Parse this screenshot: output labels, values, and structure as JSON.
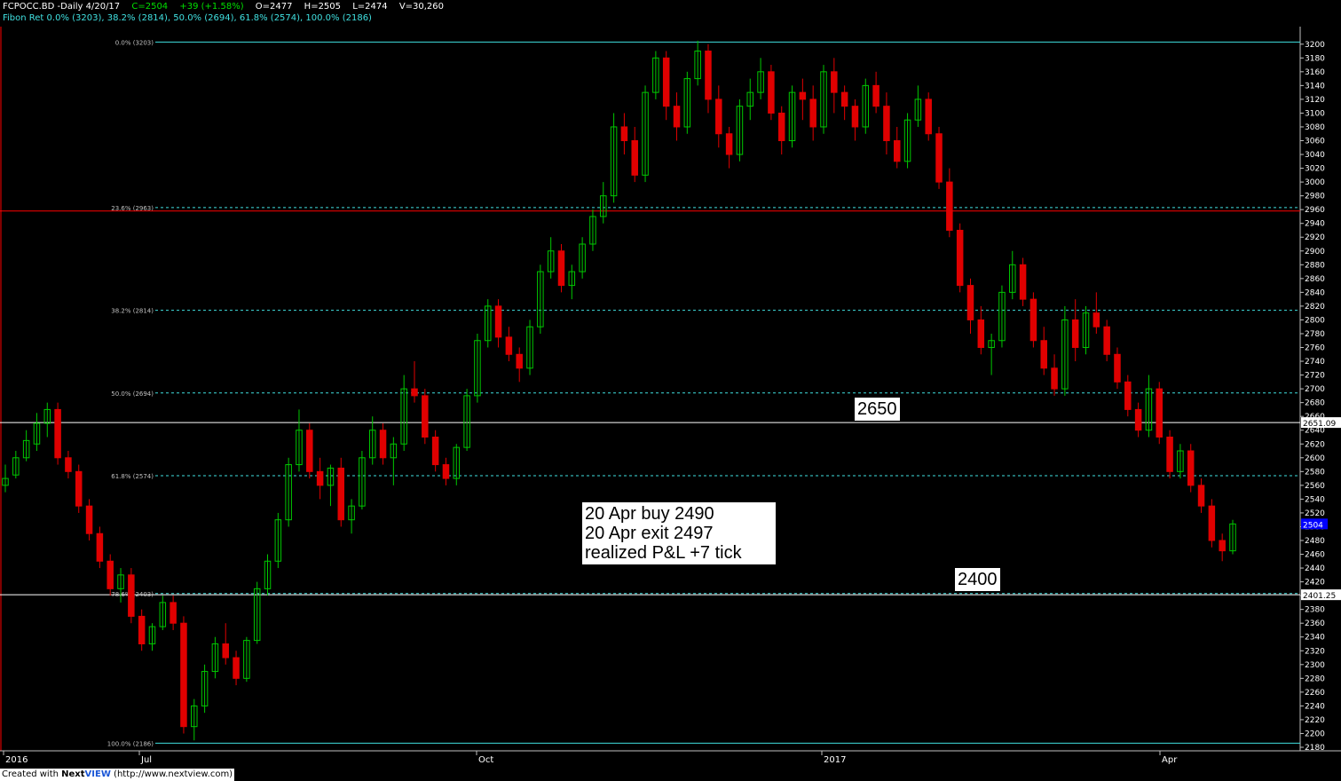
{
  "header": {
    "symbol_line": "FCPOCC.BD -Daily  4/20/17",
    "close": "C=2504",
    "change": "+39 (+1.58%)",
    "open": "O=2477",
    "high": "H=2505",
    "low": "L=2474",
    "volume": "V=30,260",
    "fib_line": "Fibon Ret 0.0% (3203), 38.2% (2814), 50.0% (2694), 61.8% (2574), 100.0% (2186)"
  },
  "annotations": {
    "trade_line1": "20 Apr buy 2490",
    "trade_line2": "20 Apr exit 2497",
    "trade_line3": "realized P&L +7 tick",
    "level_upper": "2650",
    "level_lower": "2400"
  },
  "footer": {
    "prefix": "Created with ",
    "brand_a": "Next",
    "brand_b": "VIEW",
    "url": " (http://www.nextview.com)"
  },
  "colors": {
    "background": "#000000",
    "up_candle": "#00c800",
    "down_candle": "#e00000",
    "fib_line": "#40e0e0",
    "resistance_line": "#ff0000",
    "price_tag": "#0000ff"
  },
  "chart_data": {
    "type": "candlestick",
    "title": "FCPOCC.BD -Daily",
    "ylim": [
      2180,
      3210
    ],
    "y_ticks": [
      2180,
      2200,
      2220,
      2240,
      2260,
      2280,
      2300,
      2320,
      2340,
      2360,
      2380,
      2400,
      2420,
      2440,
      2460,
      2480,
      2500,
      2520,
      2540,
      2560,
      2580,
      2600,
      2620,
      2640,
      2660,
      2680,
      2700,
      2720,
      2740,
      2760,
      2780,
      2800,
      2820,
      2840,
      2860,
      2880,
      2900,
      2920,
      2940,
      2960,
      2980,
      3000,
      3020,
      3040,
      3060,
      3080,
      3100,
      3120,
      3140,
      3160,
      3180,
      3200
    ],
    "x_labels": [
      "2016",
      "Jul",
      "Oct",
      "2017",
      "Apr"
    ],
    "fib_levels": [
      {
        "label": "0.0% (3203)",
        "value": 3203
      },
      {
        "label": "23.6% (2963)",
        "value": 2963
      },
      {
        "label": "38.2% (2814)",
        "value": 2814
      },
      {
        "label": "50.0% (2694)",
        "value": 2694
      },
      {
        "label": "61.8% (2574)",
        "value": 2574
      },
      {
        "label": "78.6% (2403)",
        "value": 2403
      },
      {
        "label": "100.0% (2186)",
        "value": 2186
      }
    ],
    "horizontal_lines": [
      {
        "value": 2958,
        "color": "#ff0000"
      },
      {
        "value": 2651.09,
        "color": "#ffffff",
        "label": "2651.09"
      },
      {
        "value": 2401.25,
        "color": "#ffffff",
        "label": "2401.25"
      }
    ],
    "last_price": {
      "value": 2504,
      "label": "2504"
    },
    "candles_ohlc": [
      [
        2560,
        2590,
        2550,
        2570
      ],
      [
        2575,
        2610,
        2570,
        2600
      ],
      [
        2600,
        2640,
        2595,
        2625
      ],
      [
        2620,
        2665,
        2610,
        2650
      ],
      [
        2650,
        2680,
        2630,
        2670
      ],
      [
        2670,
        2680,
        2590,
        2600
      ],
      [
        2600,
        2610,
        2570,
        2580
      ],
      [
        2580,
        2590,
        2520,
        2530
      ],
      [
        2530,
        2540,
        2480,
        2490
      ],
      [
        2490,
        2500,
        2440,
        2450
      ],
      [
        2450,
        2460,
        2400,
        2410
      ],
      [
        2410,
        2440,
        2390,
        2430
      ],
      [
        2430,
        2440,
        2360,
        2370
      ],
      [
        2370,
        2380,
        2320,
        2330
      ],
      [
        2330,
        2360,
        2320,
        2355
      ],
      [
        2355,
        2400,
        2350,
        2390
      ],
      [
        2390,
        2400,
        2350,
        2360
      ],
      [
        2360,
        2370,
        2200,
        2210
      ],
      [
        2210,
        2250,
        2190,
        2240
      ],
      [
        2240,
        2300,
        2230,
        2290
      ],
      [
        2290,
        2340,
        2280,
        2330
      ],
      [
        2330,
        2360,
        2300,
        2310
      ],
      [
        2310,
        2320,
        2270,
        2280
      ],
      [
        2280,
        2340,
        2275,
        2335
      ],
      [
        2335,
        2420,
        2330,
        2410
      ],
      [
        2410,
        2460,
        2400,
        2450
      ],
      [
        2450,
        2520,
        2440,
        2510
      ],
      [
        2510,
        2600,
        2500,
        2590
      ],
      [
        2590,
        2670,
        2580,
        2640
      ],
      [
        2640,
        2650,
        2570,
        2580
      ],
      [
        2580,
        2600,
        2540,
        2560
      ],
      [
        2560,
        2590,
        2530,
        2585
      ],
      [
        2585,
        2600,
        2500,
        2510
      ],
      [
        2510,
        2540,
        2490,
        2530
      ],
      [
        2530,
        2610,
        2525,
        2600
      ],
      [
        2600,
        2660,
        2590,
        2640
      ],
      [
        2640,
        2650,
        2590,
        2600
      ],
      [
        2600,
        2630,
        2560,
        2620
      ],
      [
        2620,
        2720,
        2610,
        2700
      ],
      [
        2700,
        2740,
        2680,
        2690
      ],
      [
        2690,
        2700,
        2620,
        2630
      ],
      [
        2630,
        2640,
        2580,
        2590
      ],
      [
        2590,
        2600,
        2560,
        2570
      ],
      [
        2570,
        2620,
        2560,
        2615
      ],
      [
        2615,
        2700,
        2610,
        2690
      ],
      [
        2690,
        2780,
        2680,
        2770
      ],
      [
        2770,
        2830,
        2760,
        2820
      ],
      [
        2820,
        2830,
        2760,
        2775
      ],
      [
        2775,
        2790,
        2740,
        2750
      ],
      [
        2750,
        2760,
        2710,
        2730
      ],
      [
        2730,
        2800,
        2720,
        2790
      ],
      [
        2790,
        2880,
        2780,
        2870
      ],
      [
        2870,
        2920,
        2860,
        2900
      ],
      [
        2900,
        2910,
        2840,
        2850
      ],
      [
        2850,
        2880,
        2830,
        2870
      ],
      [
        2870,
        2920,
        2860,
        2910
      ],
      [
        2910,
        2960,
        2900,
        2950
      ],
      [
        2950,
        3000,
        2940,
        2980
      ],
      [
        2980,
        3100,
        2970,
        3080
      ],
      [
        3080,
        3100,
        3040,
        3060
      ],
      [
        3060,
        3080,
        3000,
        3010
      ],
      [
        3010,
        3140,
        3000,
        3130
      ],
      [
        3130,
        3190,
        3120,
        3180
      ],
      [
        3180,
        3190,
        3090,
        3110
      ],
      [
        3110,
        3130,
        3060,
        3080
      ],
      [
        3080,
        3160,
        3070,
        3150
      ],
      [
        3150,
        3205,
        3140,
        3190
      ],
      [
        3190,
        3200,
        3100,
        3120
      ],
      [
        3120,
        3140,
        3050,
        3070
      ],
      [
        3070,
        3080,
        3020,
        3040
      ],
      [
        3040,
        3120,
        3030,
        3110
      ],
      [
        3110,
        3150,
        3090,
        3130
      ],
      [
        3130,
        3180,
        3120,
        3160
      ],
      [
        3160,
        3170,
        3090,
        3100
      ],
      [
        3100,
        3110,
        3040,
        3060
      ],
      [
        3060,
        3140,
        3050,
        3130
      ],
      [
        3130,
        3150,
        3090,
        3120
      ],
      [
        3120,
        3140,
        3060,
        3080
      ],
      [
        3080,
        3170,
        3070,
        3160
      ],
      [
        3160,
        3180,
        3100,
        3130
      ],
      [
        3130,
        3140,
        3090,
        3110
      ],
      [
        3110,
        3120,
        3060,
        3080
      ],
      [
        3080,
        3150,
        3070,
        3140
      ],
      [
        3140,
        3160,
        3100,
        3110
      ],
      [
        3110,
        3130,
        3040,
        3060
      ],
      [
        3060,
        3080,
        3020,
        3030
      ],
      [
        3030,
        3100,
        3020,
        3090
      ],
      [
        3090,
        3140,
        3080,
        3120
      ],
      [
        3120,
        3130,
        3060,
        3070
      ],
      [
        3070,
        3080,
        2990,
        3000
      ],
      [
        3000,
        3020,
        2920,
        2930
      ],
      [
        2930,
        2940,
        2840,
        2850
      ],
      [
        2850,
        2860,
        2780,
        2800
      ],
      [
        2800,
        2820,
        2750,
        2760
      ],
      [
        2760,
        2780,
        2720,
        2770
      ],
      [
        2770,
        2850,
        2760,
        2840
      ],
      [
        2840,
        2900,
        2830,
        2880
      ],
      [
        2880,
        2890,
        2820,
        2830
      ],
      [
        2830,
        2840,
        2760,
        2770
      ],
      [
        2770,
        2790,
        2720,
        2730
      ],
      [
        2730,
        2750,
        2690,
        2700
      ],
      [
        2700,
        2820,
        2690,
        2800
      ],
      [
        2800,
        2830,
        2740,
        2760
      ],
      [
        2760,
        2820,
        2750,
        2810
      ],
      [
        2810,
        2840,
        2780,
        2790
      ],
      [
        2790,
        2800,
        2740,
        2750
      ],
      [
        2750,
        2760,
        2700,
        2710
      ],
      [
        2710,
        2720,
        2660,
        2670
      ],
      [
        2670,
        2680,
        2630,
        2640
      ],
      [
        2640,
        2720,
        2630,
        2700
      ],
      [
        2700,
        2710,
        2620,
        2630
      ],
      [
        2630,
        2640,
        2570,
        2580
      ],
      [
        2580,
        2620,
        2570,
        2610
      ],
      [
        2610,
        2620,
        2550,
        2560
      ],
      [
        2560,
        2570,
        2520,
        2530
      ],
      [
        2530,
        2540,
        2470,
        2480
      ],
      [
        2480,
        2490,
        2450,
        2465
      ],
      [
        2465,
        2510,
        2460,
        2504
      ]
    ]
  }
}
